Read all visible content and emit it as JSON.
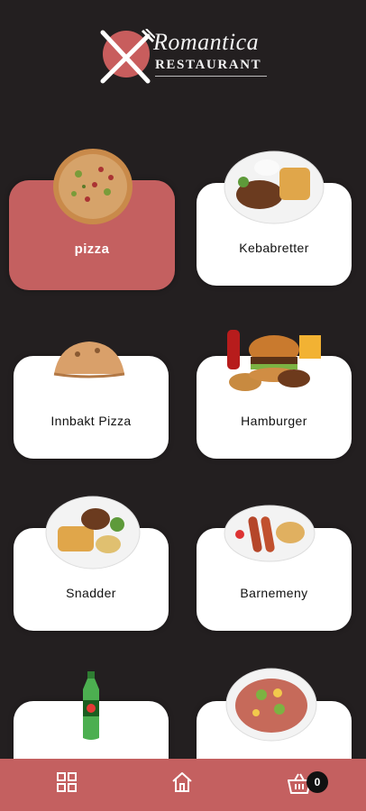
{
  "brand": {
    "script_name": "Romantica",
    "sub_name": "RESTAURANT",
    "accent_color": "#c46060"
  },
  "categories": [
    {
      "label": "pizza",
      "active": true,
      "image_icon": "pizza-image"
    },
    {
      "label": "Kebabretter",
      "active": false,
      "image_icon": "kebab-plate-image"
    },
    {
      "label": "Innbakt Pizza",
      "active": false,
      "image_icon": "calzone-image"
    },
    {
      "label": "Hamburger",
      "active": false,
      "image_icon": "hamburger-meal-image"
    },
    {
      "label": "Snadder",
      "active": false,
      "image_icon": "snack-plate-image"
    },
    {
      "label": "Barnemeny",
      "active": false,
      "image_icon": "kids-menu-plate-image"
    },
    {
      "label": "",
      "active": false,
      "image_icon": "soda-bottle-image"
    },
    {
      "label": "",
      "active": false,
      "image_icon": "salad-plate-image"
    }
  ],
  "bottom_nav": {
    "grid_icon": "grid-icon",
    "home_icon": "home-icon",
    "cart_icon": "cart-icon",
    "cart_count": "0"
  }
}
